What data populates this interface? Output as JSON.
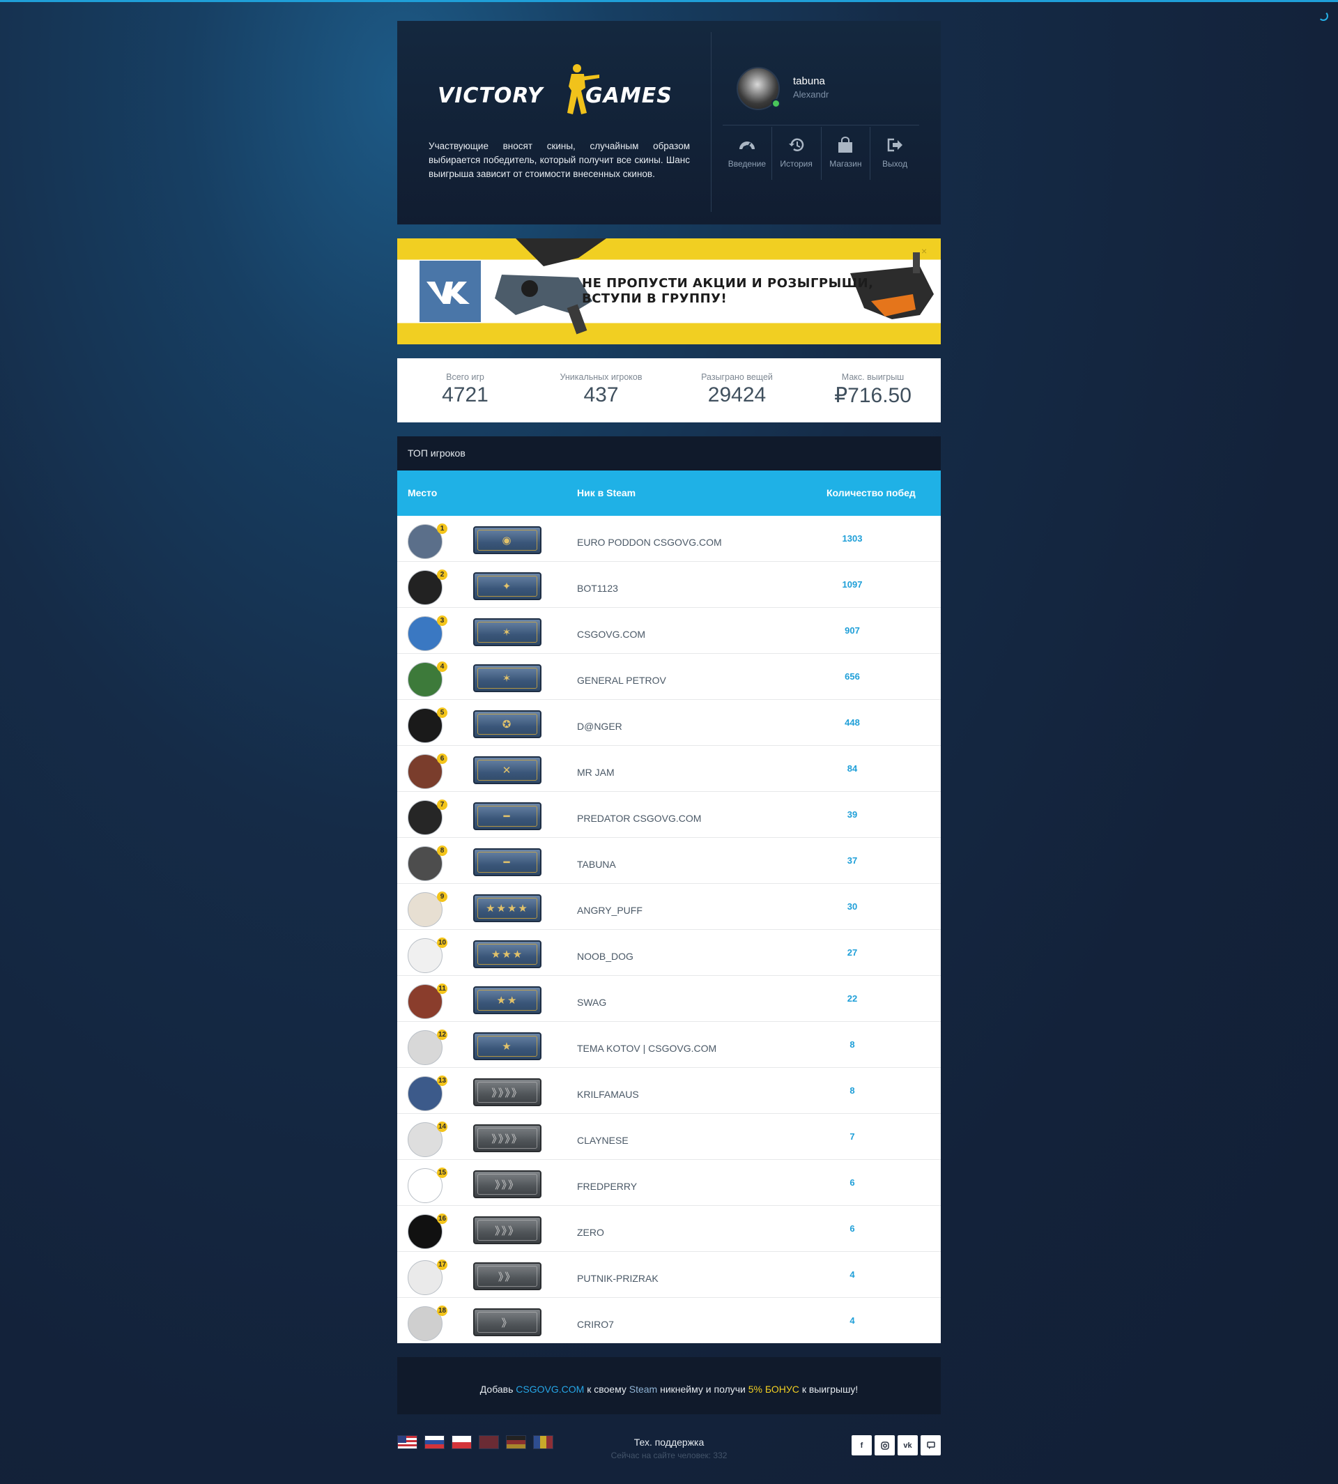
{
  "header": {
    "logo_left": "VICTORY",
    "logo_right": "GAMES",
    "description": "Участвующие вносят скины, случайным образом выбирается победитель, который получит все скины. Шанс выигрыша зависит от стоимости внесенных скинов."
  },
  "user": {
    "username": "tabuna",
    "real_name": "Alexandr",
    "status": "online"
  },
  "nav": [
    {
      "label": "Введение",
      "icon": "dashboard-icon"
    },
    {
      "label": "История",
      "icon": "history-icon"
    },
    {
      "label": "Магазин",
      "icon": "shopping-bag-icon"
    },
    {
      "label": "Выход",
      "icon": "logout-icon"
    }
  ],
  "banner": {
    "line1": "НЕ ПРОПУСТИ АКЦИИ И РОЗЫГРЫШИ,",
    "line2": "ВСТУПИ В ГРУППУ!",
    "close": "×",
    "brand_color": "#4a76a8",
    "accent_color": "#f1cf22"
  },
  "stats": [
    {
      "label": "Всего игр",
      "value": "4721"
    },
    {
      "label": "Уникальных игроков",
      "value": "437"
    },
    {
      "label": "Разыграно вещей",
      "value": "29424"
    },
    {
      "label": "Макс. выигрыш",
      "value": "₽716.50"
    }
  ],
  "top": {
    "title": "ТОП игроков",
    "columns": {
      "place": "Место",
      "nick": "Ник в Steam",
      "wins": "Количество побед"
    },
    "players": [
      {
        "place": "1",
        "name": "EURO PODDON CSGOVG.COM",
        "wins": "1303"
      },
      {
        "place": "2",
        "name": "BOT1123",
        "wins": "1097"
      },
      {
        "place": "3",
        "name": "CSGOVG.COM",
        "wins": "907"
      },
      {
        "place": "4",
        "name": "GENERAL PETROV",
        "wins": "656"
      },
      {
        "place": "5",
        "name": "D@NGER",
        "wins": "448"
      },
      {
        "place": "6",
        "name": "MR JAM",
        "wins": "84"
      },
      {
        "place": "7",
        "name": "PREDATOR CSGOVG.COM",
        "wins": "39"
      },
      {
        "place": "8",
        "name": "TABUNA",
        "wins": "37"
      },
      {
        "place": "9",
        "name": "ANGRY_PUFF",
        "wins": "30"
      },
      {
        "place": "10",
        "name": "NOOB_DOG",
        "wins": "27"
      },
      {
        "place": "11",
        "name": "SWAG",
        "wins": "22"
      },
      {
        "place": "12",
        "name": "TEMA KOTOV | CSGOVG.COM",
        "wins": "8"
      },
      {
        "place": "13",
        "name": "KRILFAMAUS",
        "wins": "8"
      },
      {
        "place": "14",
        "name": "CLAYNESE",
        "wins": "7"
      },
      {
        "place": "15",
        "name": "FREDPERRY",
        "wins": "6"
      },
      {
        "place": "16",
        "name": "ZERO",
        "wins": "6"
      },
      {
        "place": "17",
        "name": "PUTNIK-PRIZRAK",
        "wins": "4"
      },
      {
        "place": "18",
        "name": "CRIRO7",
        "wins": "4"
      }
    ]
  },
  "bonus": {
    "prefix": "Добавь",
    "site": "CSGOVG.COM",
    "mid1": "к своему",
    "steam": "Steam",
    "mid2": "никнейму и получи",
    "bonus": "5% БОНУС",
    "suffix": "к выигрышу!"
  },
  "footer": {
    "support": "Тех. поддержка",
    "online_text": "Сейчас на сайте человек: 332",
    "flags": [
      "us-flag-icon",
      "ru-flag-icon",
      "pl-flag-icon",
      "tr-flag-icon",
      "de-flag-icon",
      "ro-flag-icon"
    ],
    "social": [
      "facebook-icon",
      "instagram-icon",
      "vk-icon",
      "chat-icon"
    ]
  }
}
